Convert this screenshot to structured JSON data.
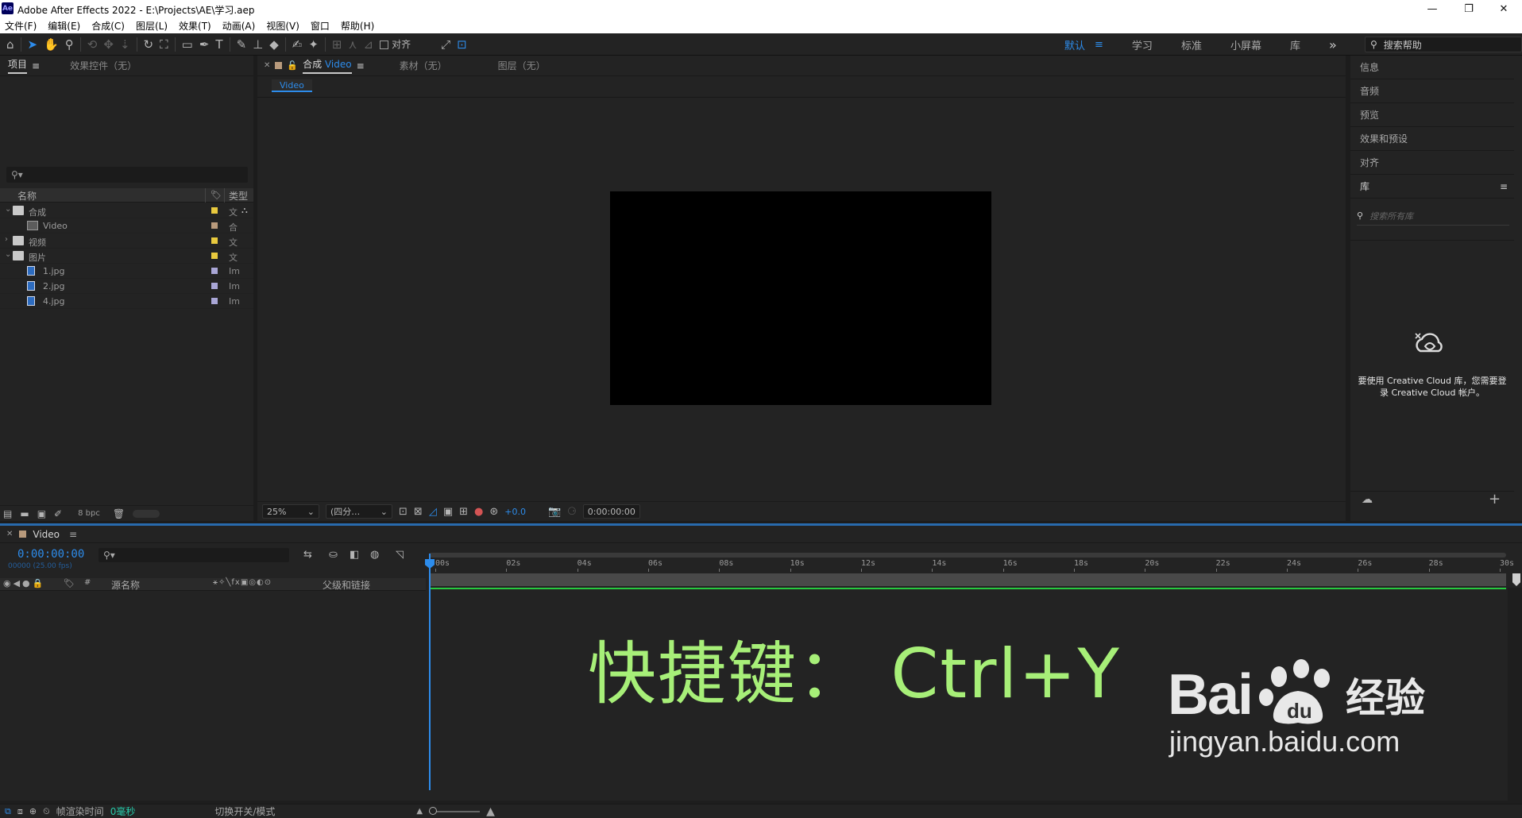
{
  "window": {
    "title": "Adobe After Effects 2022 - E:\\Projects\\AE\\学习.aep",
    "logo": "Ae",
    "min": "—",
    "max": "❐",
    "close": "✕"
  },
  "menu": [
    "文件(F)",
    "编辑(E)",
    "合成(C)",
    "图层(L)",
    "效果(T)",
    "动画(A)",
    "视图(V)",
    "窗口",
    "帮助(H)"
  ],
  "toolbar": {
    "align_label": "对齐",
    "workspaces": [
      "默认",
      "学习",
      "标准",
      "小屏幕",
      "库"
    ],
    "active_workspace": "默认",
    "overflow": "»",
    "search_placeholder": "搜索帮助"
  },
  "project": {
    "tabs": [
      "项目",
      "效果控件（无）"
    ],
    "columns": {
      "name": "名称",
      "type": "类型"
    },
    "items": [
      {
        "name": "合成",
        "type": "文",
        "kind": "folder",
        "label": "#e8c93e",
        "expanded": true,
        "indent": 0
      },
      {
        "name": "Video",
        "type": "合",
        "kind": "comp",
        "label": "#b89a7c",
        "indent": 1
      },
      {
        "name": "视频",
        "type": "文",
        "kind": "folder",
        "label": "#e8c93e",
        "expanded": false,
        "indent": 0
      },
      {
        "name": "图片",
        "type": "文",
        "kind": "folder",
        "label": "#e8c93e",
        "expanded": true,
        "indent": 0
      },
      {
        "name": "1.jpg",
        "type": "Im",
        "kind": "file",
        "label": "#a9a6d6",
        "indent": 1
      },
      {
        "name": "2.jpg",
        "type": "Im",
        "kind": "file",
        "label": "#a9a6d6",
        "indent": 1
      },
      {
        "name": "4.jpg",
        "type": "Im",
        "kind": "file",
        "label": "#a9a6d6",
        "indent": 1
      }
    ],
    "bpc": "8 bpc"
  },
  "viewer": {
    "tabs": [
      {
        "prefix": "合成",
        "name": "Video"
      },
      {
        "name": "素材（无）"
      },
      {
        "name": "图层（无）"
      }
    ],
    "comp_chip": "Video",
    "zoom": "25%",
    "resolution": "(四分…",
    "exposure": "+0.0",
    "time": "0:00:00:00"
  },
  "right_panel": {
    "sections": [
      "信息",
      "音频",
      "预览",
      "效果和预设",
      "对齐",
      "库"
    ],
    "lib_search_placeholder": "搜索所有库",
    "cc_message": "要使用 Creative Cloud 库，您需要登录 Creative Cloud 帐户。",
    "add": "+"
  },
  "timeline": {
    "comp_tab": "Video",
    "timecode": "0:00:00:00",
    "frame_info": "00000 (25.00 fps)",
    "columns": {
      "source_name": "源名称",
      "parent": "父级和链接",
      "hash": "#"
    },
    "ruler": [
      "00s",
      "02s",
      "04s",
      "06s",
      "08s",
      "10s",
      "12s",
      "14s",
      "16s",
      "18s",
      "20s",
      "22s",
      "24s",
      "26s",
      "28s",
      "30s"
    ],
    "footer": {
      "render_label": "帧渲染时间",
      "render_value": "0毫秒",
      "toggle_label": "切换开关/模式"
    }
  },
  "overlay": {
    "shortcut_text": "快捷键： Ctrl+Y"
  },
  "watermark": {
    "brand": "Bai",
    "brand_suffix": "经验",
    "url": "jingyan.baidu.com"
  },
  "colors": {
    "accent": "#2d8ceb",
    "overlay_text": "#a7ef78",
    "folder_label": "#e8c93e",
    "comp_label": "#b89a7c",
    "image_label": "#a9a6d6"
  }
}
